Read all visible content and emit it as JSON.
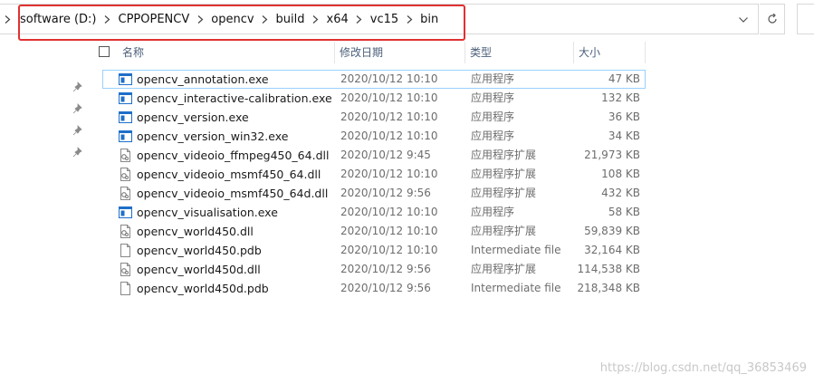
{
  "breadcrumb": [
    "software (D:)",
    "CPPOPENCV",
    "opencv",
    "build",
    "x64",
    "vc15",
    "bin"
  ],
  "columns": {
    "name": "名称",
    "date": "修改日期",
    "type": "类型",
    "size": "大小"
  },
  "files": [
    {
      "name": "opencv_annotation.exe",
      "date": "2020/10/12 10:10",
      "type": "应用程序",
      "size": "47 KB",
      "icon": "exe-icon"
    },
    {
      "name": "opencv_interactive-calibration.exe",
      "date": "2020/10/12 10:10",
      "type": "应用程序",
      "size": "132 KB",
      "icon": "exe-icon"
    },
    {
      "name": "opencv_version.exe",
      "date": "2020/10/12 10:10",
      "type": "应用程序",
      "size": "36 KB",
      "icon": "exe-icon"
    },
    {
      "name": "opencv_version_win32.exe",
      "date": "2020/10/12 10:10",
      "type": "应用程序",
      "size": "34 KB",
      "icon": "exe-icon"
    },
    {
      "name": "opencv_videoio_ffmpeg450_64.dll",
      "date": "2020/10/12 9:45",
      "type": "应用程序扩展",
      "size": "21,973 KB",
      "icon": "dll-icon"
    },
    {
      "name": "opencv_videoio_msmf450_64.dll",
      "date": "2020/10/12 10:10",
      "type": "应用程序扩展",
      "size": "108 KB",
      "icon": "dll-icon"
    },
    {
      "name": "opencv_videoio_msmf450_64d.dll",
      "date": "2020/10/12 9:56",
      "type": "应用程序扩展",
      "size": "432 KB",
      "icon": "dll-icon"
    },
    {
      "name": "opencv_visualisation.exe",
      "date": "2020/10/12 10:10",
      "type": "应用程序",
      "size": "58 KB",
      "icon": "exe-icon"
    },
    {
      "name": "opencv_world450.dll",
      "date": "2020/10/12 10:10",
      "type": "应用程序扩展",
      "size": "59,839 KB",
      "icon": "dll-icon"
    },
    {
      "name": "opencv_world450.pdb",
      "date": "2020/10/12 10:10",
      "type": "Intermediate file",
      "size": "32,164 KB",
      "icon": "file-icon"
    },
    {
      "name": "opencv_world450d.dll",
      "date": "2020/10/12 9:56",
      "type": "应用程序扩展",
      "size": "114,538 KB",
      "icon": "dll-icon"
    },
    {
      "name": "opencv_world450d.pdb",
      "date": "2020/10/12 9:56",
      "type": "Intermediate file",
      "size": "218,348 KB",
      "icon": "file-icon"
    }
  ],
  "watermark": "https://blog.csdn.net/qq_36853469",
  "colors": {
    "highlight": "#e03131",
    "header_text": "#4c607a",
    "exe_blue": "#1e6fc8",
    "selection": "#99d1ff"
  }
}
